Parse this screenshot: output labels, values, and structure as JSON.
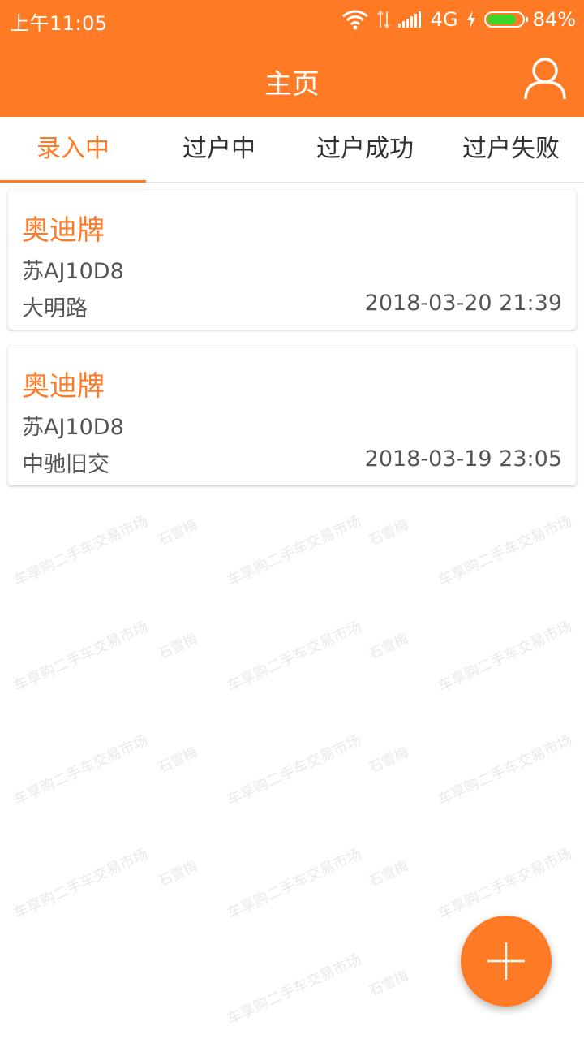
{
  "status_bar": {
    "time": "上午11:05",
    "network": "4G",
    "battery_text": "84%",
    "battery_level": 0.84
  },
  "header": {
    "title": "主页",
    "user_icon": "user-icon"
  },
  "tabs": [
    {
      "label": "录入中",
      "active": true
    },
    {
      "label": "过户中",
      "active": false
    },
    {
      "label": "过户成功",
      "active": false
    },
    {
      "label": "过户失败",
      "active": false
    }
  ],
  "records": [
    {
      "brand": "奥迪牌",
      "plate": "苏AJ10D8",
      "location": "大明路",
      "time": "2018-03-20 21:39"
    },
    {
      "brand": "奥迪牌",
      "plate": "苏AJ10D8",
      "location": "中驰旧交",
      "time": "2018-03-19 23:05"
    }
  ],
  "watermark": {
    "text": "车享购二手车交易市场",
    "name": "石雪梅"
  },
  "fab": {
    "icon": "plus-icon"
  },
  "colors": {
    "accent": "#ff7a25",
    "battery": "#3fd42c"
  }
}
